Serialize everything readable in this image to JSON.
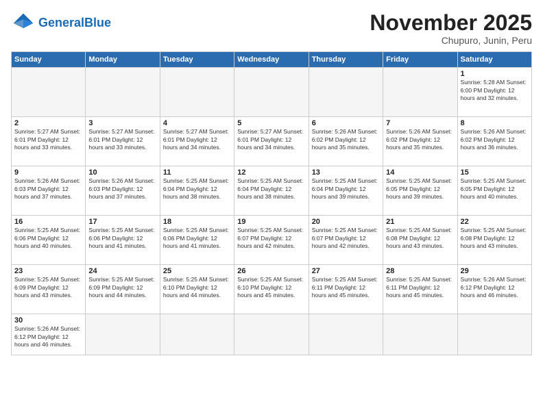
{
  "header": {
    "logo_general": "General",
    "logo_blue": "Blue",
    "month_title": "November 2025",
    "location": "Chupuro, Junin, Peru"
  },
  "days_of_week": [
    "Sunday",
    "Monday",
    "Tuesday",
    "Wednesday",
    "Thursday",
    "Friday",
    "Saturday"
  ],
  "weeks": [
    [
      {
        "day": "",
        "info": "",
        "empty": true
      },
      {
        "day": "",
        "info": "",
        "empty": true
      },
      {
        "day": "",
        "info": "",
        "empty": true
      },
      {
        "day": "",
        "info": "",
        "empty": true
      },
      {
        "day": "",
        "info": "",
        "empty": true
      },
      {
        "day": "",
        "info": "",
        "empty": true
      },
      {
        "day": "1",
        "info": "Sunrise: 5:28 AM\nSunset: 6:00 PM\nDaylight: 12 hours\nand 32 minutes."
      }
    ],
    [
      {
        "day": "2",
        "info": "Sunrise: 5:27 AM\nSunset: 6:01 PM\nDaylight: 12 hours\nand 33 minutes."
      },
      {
        "day": "3",
        "info": "Sunrise: 5:27 AM\nSunset: 6:01 PM\nDaylight: 12 hours\nand 33 minutes."
      },
      {
        "day": "4",
        "info": "Sunrise: 5:27 AM\nSunset: 6:01 PM\nDaylight: 12 hours\nand 34 minutes."
      },
      {
        "day": "5",
        "info": "Sunrise: 5:27 AM\nSunset: 6:01 PM\nDaylight: 12 hours\nand 34 minutes."
      },
      {
        "day": "6",
        "info": "Sunrise: 5:26 AM\nSunset: 6:02 PM\nDaylight: 12 hours\nand 35 minutes."
      },
      {
        "day": "7",
        "info": "Sunrise: 5:26 AM\nSunset: 6:02 PM\nDaylight: 12 hours\nand 35 minutes."
      },
      {
        "day": "8",
        "info": "Sunrise: 5:26 AM\nSunset: 6:02 PM\nDaylight: 12 hours\nand 36 minutes."
      }
    ],
    [
      {
        "day": "9",
        "info": "Sunrise: 5:26 AM\nSunset: 6:03 PM\nDaylight: 12 hours\nand 37 minutes."
      },
      {
        "day": "10",
        "info": "Sunrise: 5:26 AM\nSunset: 6:03 PM\nDaylight: 12 hours\nand 37 minutes."
      },
      {
        "day": "11",
        "info": "Sunrise: 5:25 AM\nSunset: 6:04 PM\nDaylight: 12 hours\nand 38 minutes."
      },
      {
        "day": "12",
        "info": "Sunrise: 5:25 AM\nSunset: 6:04 PM\nDaylight: 12 hours\nand 38 minutes."
      },
      {
        "day": "13",
        "info": "Sunrise: 5:25 AM\nSunset: 6:04 PM\nDaylight: 12 hours\nand 39 minutes."
      },
      {
        "day": "14",
        "info": "Sunrise: 5:25 AM\nSunset: 6:05 PM\nDaylight: 12 hours\nand 39 minutes."
      },
      {
        "day": "15",
        "info": "Sunrise: 5:25 AM\nSunset: 6:05 PM\nDaylight: 12 hours\nand 40 minutes."
      }
    ],
    [
      {
        "day": "16",
        "info": "Sunrise: 5:25 AM\nSunset: 6:06 PM\nDaylight: 12 hours\nand 40 minutes."
      },
      {
        "day": "17",
        "info": "Sunrise: 5:25 AM\nSunset: 6:06 PM\nDaylight: 12 hours\nand 41 minutes."
      },
      {
        "day": "18",
        "info": "Sunrise: 5:25 AM\nSunset: 6:06 PM\nDaylight: 12 hours\nand 41 minutes."
      },
      {
        "day": "19",
        "info": "Sunrise: 5:25 AM\nSunset: 6:07 PM\nDaylight: 12 hours\nand 42 minutes."
      },
      {
        "day": "20",
        "info": "Sunrise: 5:25 AM\nSunset: 6:07 PM\nDaylight: 12 hours\nand 42 minutes."
      },
      {
        "day": "21",
        "info": "Sunrise: 5:25 AM\nSunset: 6:08 PM\nDaylight: 12 hours\nand 43 minutes."
      },
      {
        "day": "22",
        "info": "Sunrise: 5:25 AM\nSunset: 6:08 PM\nDaylight: 12 hours\nand 43 minutes."
      }
    ],
    [
      {
        "day": "23",
        "info": "Sunrise: 5:25 AM\nSunset: 6:09 PM\nDaylight: 12 hours\nand 43 minutes."
      },
      {
        "day": "24",
        "info": "Sunrise: 5:25 AM\nSunset: 6:09 PM\nDaylight: 12 hours\nand 44 minutes."
      },
      {
        "day": "25",
        "info": "Sunrise: 5:25 AM\nSunset: 6:10 PM\nDaylight: 12 hours\nand 44 minutes."
      },
      {
        "day": "26",
        "info": "Sunrise: 5:25 AM\nSunset: 6:10 PM\nDaylight: 12 hours\nand 45 minutes."
      },
      {
        "day": "27",
        "info": "Sunrise: 5:25 AM\nSunset: 6:11 PM\nDaylight: 12 hours\nand 45 minutes."
      },
      {
        "day": "28",
        "info": "Sunrise: 5:25 AM\nSunset: 6:11 PM\nDaylight: 12 hours\nand 45 minutes."
      },
      {
        "day": "29",
        "info": "Sunrise: 5:26 AM\nSunset: 6:12 PM\nDaylight: 12 hours\nand 46 minutes."
      }
    ],
    [
      {
        "day": "30",
        "info": "Sunrise: 5:26 AM\nSunset: 6:12 PM\nDaylight: 12 hours\nand 46 minutes."
      },
      {
        "day": "",
        "info": "",
        "empty": true
      },
      {
        "day": "",
        "info": "",
        "empty": true
      },
      {
        "day": "",
        "info": "",
        "empty": true
      },
      {
        "day": "",
        "info": "",
        "empty": true
      },
      {
        "day": "",
        "info": "",
        "empty": true
      },
      {
        "day": "",
        "info": "",
        "empty": true
      }
    ]
  ]
}
